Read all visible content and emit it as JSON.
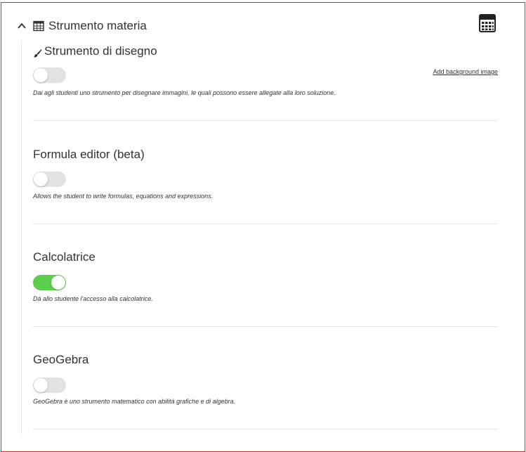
{
  "panel": {
    "title": "Strumento materia",
    "header_icon": "grid-table-icon",
    "collapse_icon": "chevron-up-icon",
    "calculator_icon": "calculator-icon"
  },
  "sections": [
    {
      "title": "Strumento di disegno",
      "icon": "paintbrush-icon",
      "toggle_on": false,
      "description": "Dai agli studenti uno strumento per disegnare immagini, le quali possono essere allegate alla loro soluzione.",
      "link_label": "Add background image"
    },
    {
      "title": "Formula editor (beta)",
      "toggle_on": false,
      "description": "Allows the student to write formulas, equations and expressions."
    },
    {
      "title": "Calcolatrice",
      "toggle_on": true,
      "description": "Dà allo studente l'accesso alla calcolatrice."
    },
    {
      "title": "GeoGebra",
      "toggle_on": false,
      "description": "GeoGebra è uno strumento matematico con abilità grafiche e di algebra."
    }
  ],
  "colors": {
    "toggle_on": "#5ccf4e",
    "toggle_off": "#e2e2e2",
    "frame_border": "#c9302c"
  }
}
